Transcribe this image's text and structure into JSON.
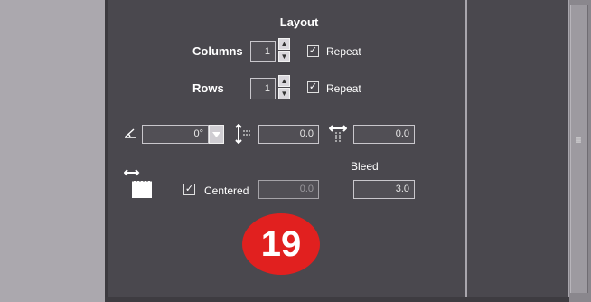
{
  "layout": {
    "title": "Layout",
    "columns_label": "Columns",
    "columns_value": "1",
    "rows_label": "Rows",
    "rows_value": "1",
    "repeat_columns_label": "Repeat",
    "repeat_columns_checked": true,
    "repeat_rows_label": "Repeat",
    "repeat_rows_checked": true
  },
  "transform": {
    "angle_value": "0°",
    "vertical_spacing_value": "0.0",
    "horizontal_spacing_value": "0.0"
  },
  "bleed": {
    "label": "Bleed",
    "centered_label": "Centered",
    "centered_checked": true,
    "offset_value": "0.0",
    "bleed_value": "3.0"
  },
  "badge": {
    "number": "19",
    "color": "#e1201f"
  },
  "icons": [
    "angle-icon",
    "vertical-spacing-icon",
    "horizontal-spacing-icon",
    "bleed-page-icon",
    "dropdown-arrow-icon",
    "grip-icon"
  ]
}
